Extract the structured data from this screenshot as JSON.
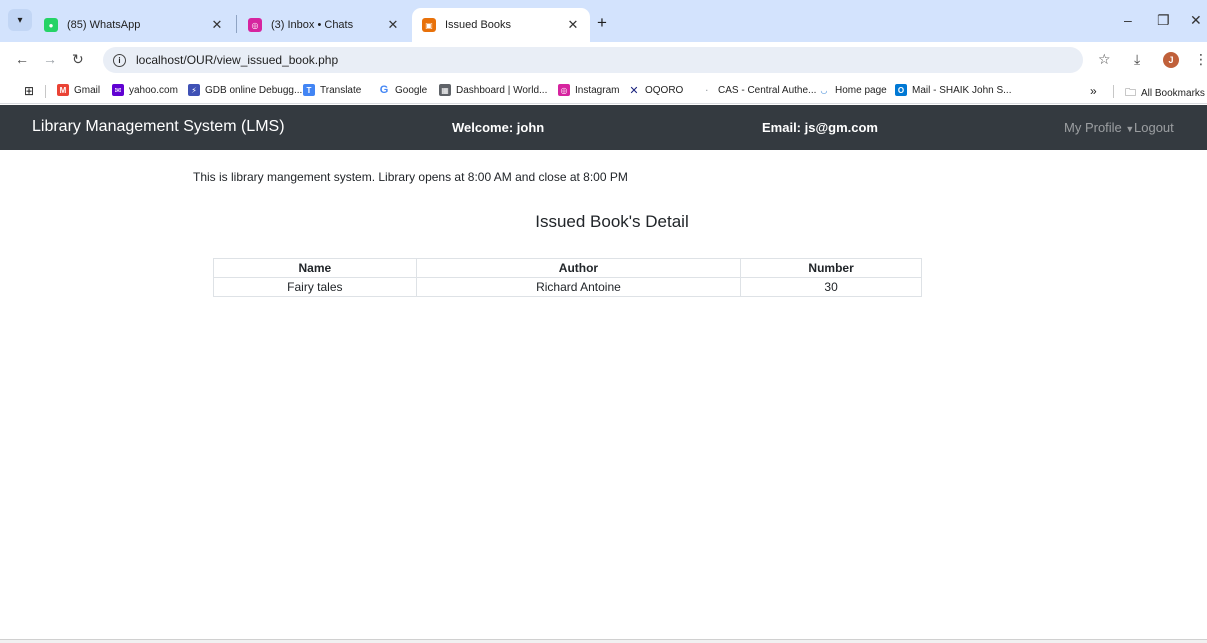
{
  "browser": {
    "tabs": [
      {
        "title": "(85) WhatsApp",
        "favicon": "whatsapp-icon",
        "color": "#25d366"
      },
      {
        "title": "(3) Inbox • Chats",
        "favicon": "instagram-icon",
        "color": "#d6249f"
      },
      {
        "title": "Issued Books",
        "favicon": "page-icon",
        "color": "#e8710a"
      }
    ],
    "url": "localhost/OUR/view_issued_book.php",
    "bookmarks": [
      "Gmail",
      "yahoo.com",
      "GDB online Debugg...",
      "Translate",
      "Google",
      "Dashboard | World...",
      "Instagram",
      "OQORO",
      "CAS - Central Authe...",
      "Home page",
      "Mail - SHAIK John S..."
    ],
    "all_bookmarks": "All Bookmarks",
    "avatar_letter": "J"
  },
  "navbar": {
    "brand": "Library Management System (LMS)",
    "welcome": "Welcome: john",
    "email": "Email: js@gm.com",
    "profile": "My Profile",
    "logout": "Logout",
    "background": "#343a40"
  },
  "page": {
    "intro": "This is library mangement system. Library opens at 8:00 AM and close at 8:00 PM",
    "heading": "Issued Book's Detail"
  },
  "table": {
    "headers": [
      "Name",
      "Author",
      "Number"
    ],
    "rows": [
      [
        "Fairy tales",
        "Richard Antoine",
        "30"
      ]
    ]
  }
}
